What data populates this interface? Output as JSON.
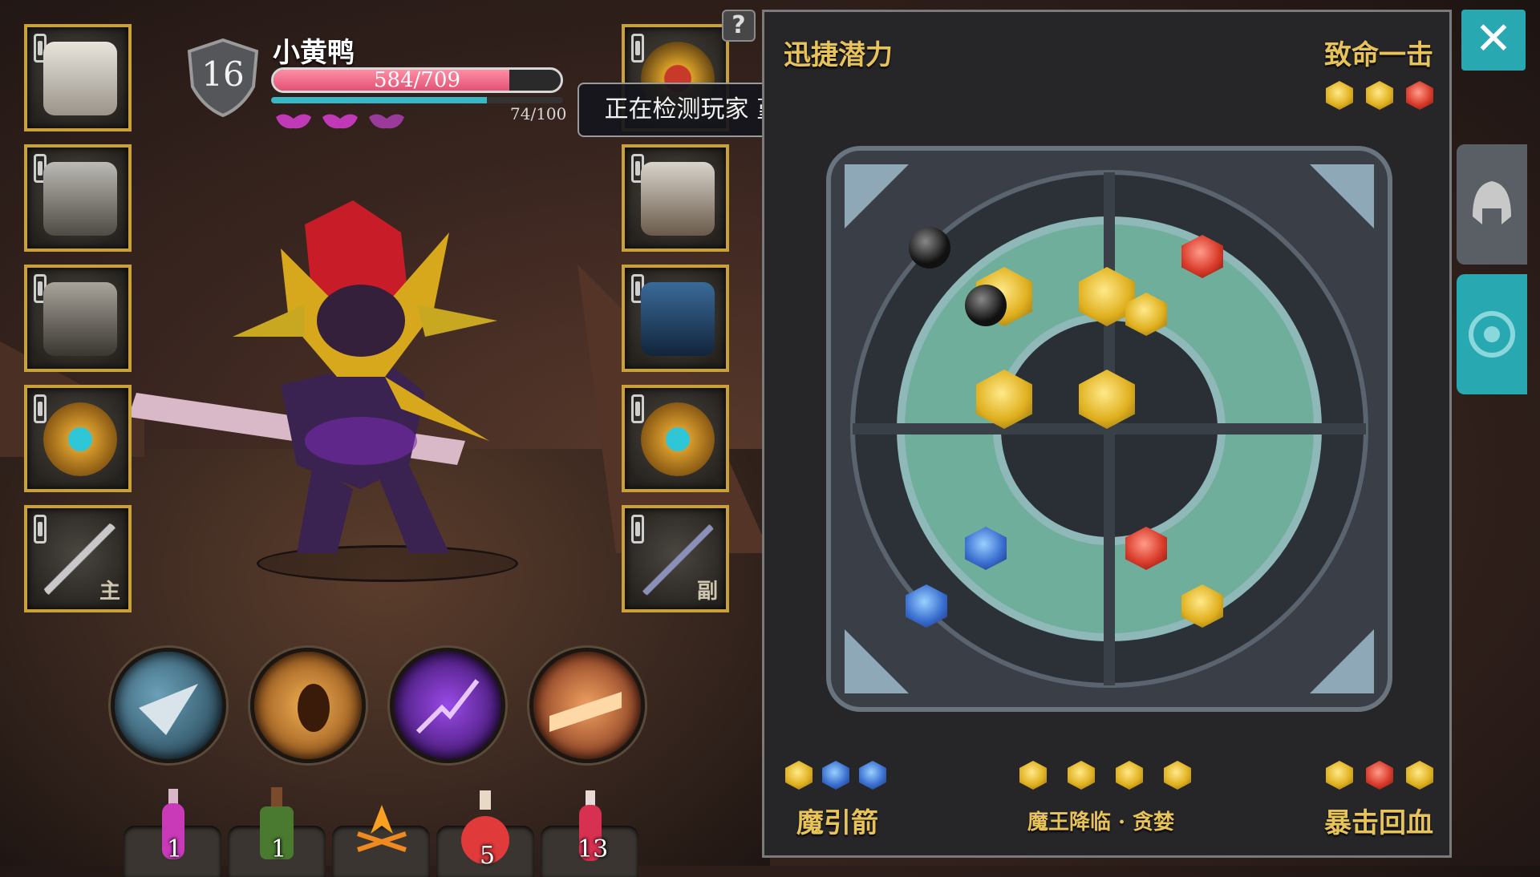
{
  "player": {
    "name": "小黄鸭",
    "level": "16",
    "hp_text": "584/709",
    "hp_fraction": 0.82,
    "mp_text": "74/100",
    "mp_fraction": 0.74,
    "lives": 3
  },
  "tooltip": "正在检测玩家 堇年 的战斗数据",
  "help_icon": "?",
  "equipment": {
    "left": [
      {
        "name": "helmet"
      },
      {
        "name": "chest-armor"
      },
      {
        "name": "shoulder-armor"
      },
      {
        "name": "ring"
      },
      {
        "name": "main-weapon",
        "tag": "主"
      }
    ],
    "right": [
      {
        "name": "necklace"
      },
      {
        "name": "gloves"
      },
      {
        "name": "boots"
      },
      {
        "name": "ring"
      },
      {
        "name": "off-weapon",
        "tag": "副"
      }
    ]
  },
  "skills": [
    "blade-skill",
    "dash-skill",
    "shadow-skill",
    "charge-skill"
  ],
  "potions": [
    {
      "count": "1",
      "color": "#c83ab8"
    },
    {
      "count": "1",
      "color": "#5a8a3a"
    },
    {
      "count": "",
      "color": "#f08a20"
    },
    {
      "count": "5",
      "color": "#e03a3a"
    },
    {
      "count": "13",
      "color": "#d83050"
    }
  ],
  "panel": {
    "top_left_title": "迅捷潜力",
    "top_right_title": "致命一击",
    "top_right_gems": [
      "y",
      "y",
      "r"
    ],
    "bottom_left_title": "魔引箭",
    "bottom_left_gems": [
      "y",
      "b",
      "b"
    ],
    "bottom_mid_title": "魔王降临 · 贪婪",
    "bottom_mid_gems": [
      "y",
      "y",
      "y",
      "y"
    ],
    "bottom_right_title": "暴击回血",
    "bottom_right_gems": [
      "y",
      "r",
      "y"
    ]
  },
  "close_label": "✕",
  "side_tabs": [
    "helmet-tab",
    "target-tab"
  ]
}
